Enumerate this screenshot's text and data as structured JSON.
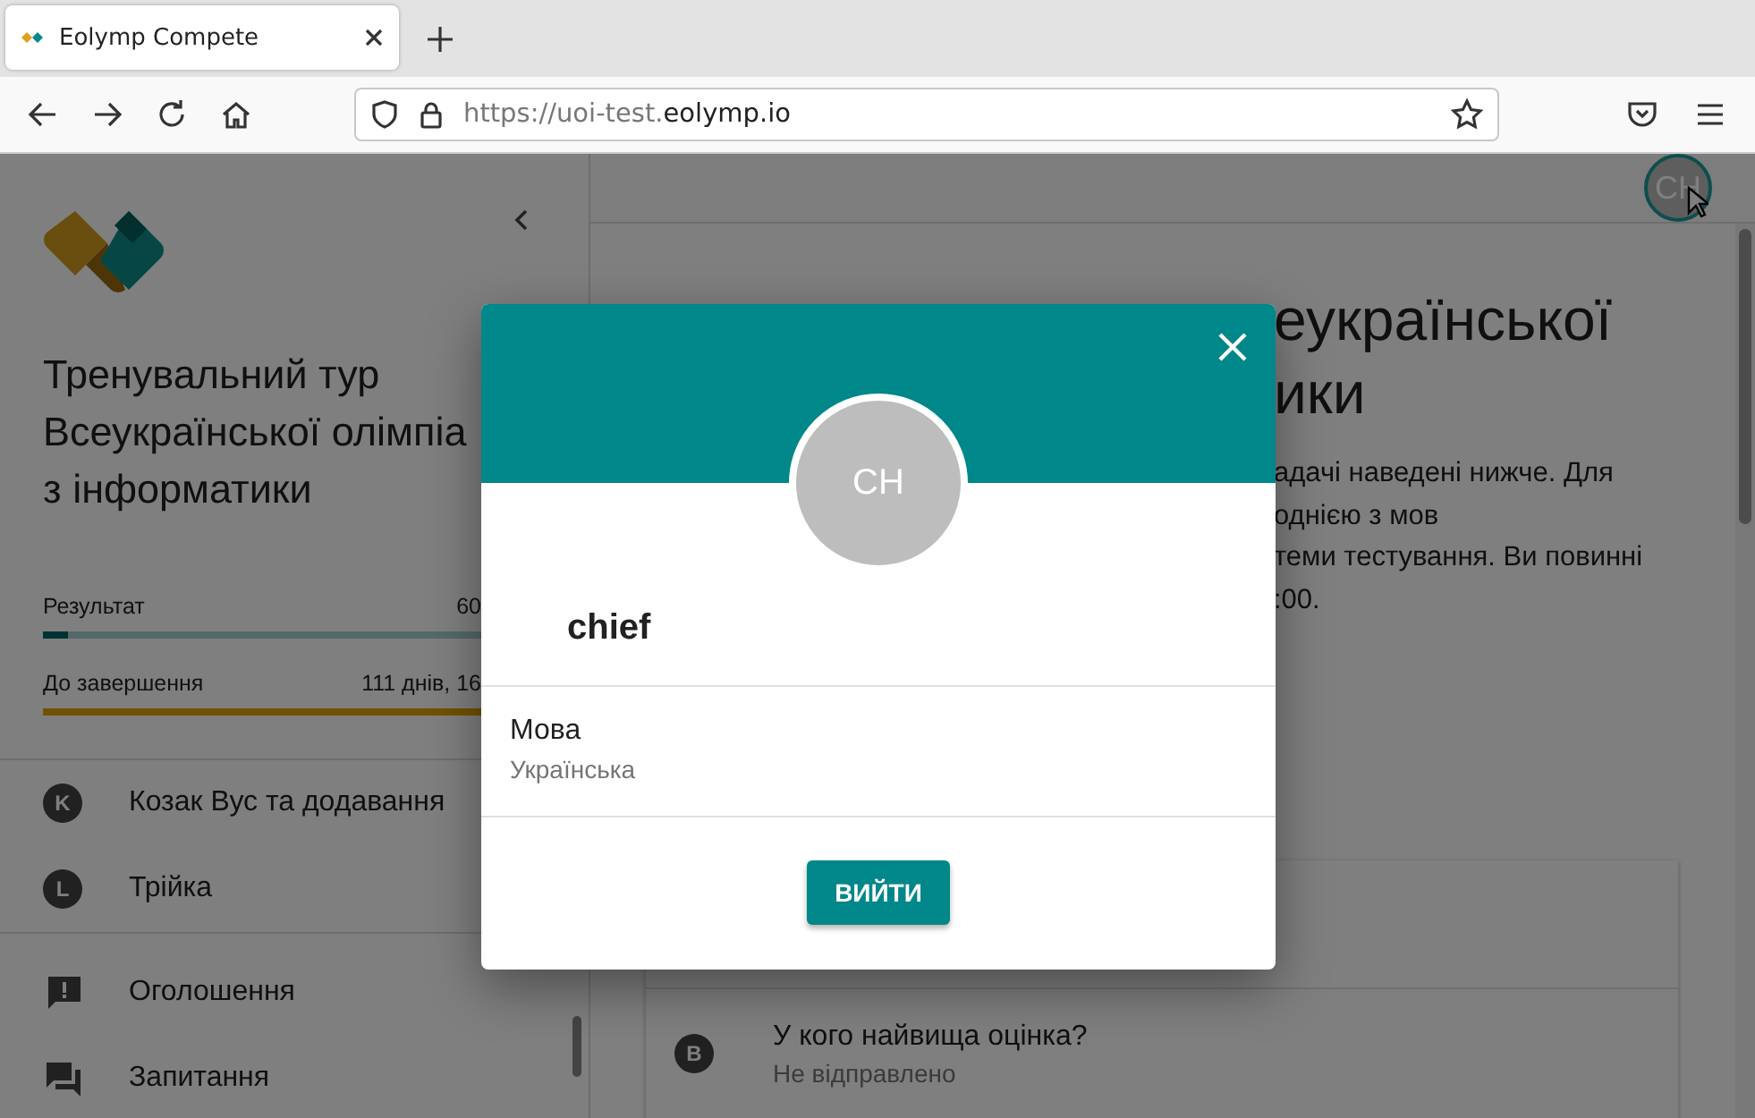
{
  "browser": {
    "tab_title": "Eolymp Compete",
    "url_prefix": "https://uoi-test.",
    "url_domain": "eolymp.io"
  },
  "sidebar": {
    "title_lines": [
      "Тренувальний тур",
      "Всеукраїнської олімпіа",
      "з інформатики"
    ],
    "result": {
      "label": "Результат",
      "value": "60",
      "level": 0.05
    },
    "countdown": {
      "label": "До завершення",
      "value": "111 днів, 16",
      "level": 1
    },
    "problems": [
      {
        "letter": "K",
        "name": "Козак Вус та додавання"
      },
      {
        "letter": "L",
        "name": "Трійка"
      }
    ],
    "links": [
      {
        "kind": "announcements",
        "label": "Оголошення"
      },
      {
        "kind": "questions",
        "label": "Запитання"
      }
    ]
  },
  "main": {
    "user_initials": "CH",
    "heading_lines": [
      "еукраїнської",
      "ики"
    ],
    "paragraph_lines": [
      "адачі наведені нижче. Для",
      "однією з мов",
      "теми тестування. Ви повинні",
      ":00."
    ],
    "problems": [
      {
        "letter": "B",
        "name": "У кого найвища оцінка?",
        "status": "Не відправлено"
      }
    ]
  },
  "dialog": {
    "initials": "CH",
    "username": "chief",
    "field_label": "Мова",
    "field_value": "Українська",
    "button": "ВИЙТИ"
  }
}
